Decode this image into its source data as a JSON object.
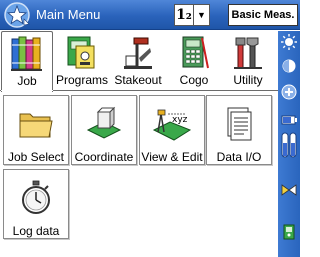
{
  "titlebar": {
    "title": "Main Menu",
    "unit_value": "1₂",
    "mode_button": "Basic Meas."
  },
  "tabs": [
    {
      "label": "Job",
      "icon": "books-icon",
      "active": true
    },
    {
      "label": "Programs",
      "icon": "programs-icon",
      "active": false
    },
    {
      "label": "Stakeout",
      "icon": "stakeout-icon",
      "active": false
    },
    {
      "label": "Cogo",
      "icon": "calculator-icon",
      "active": false
    },
    {
      "label": "Utility",
      "icon": "tools-icon",
      "active": false
    }
  ],
  "buttons": [
    {
      "label": "Job Select",
      "icon": "folder-icon"
    },
    {
      "label": "Coordinate",
      "icon": "coordinate-icon"
    },
    {
      "label": "View & Edit",
      "icon": "view-edit-icon"
    },
    {
      "label": "Data I/O",
      "icon": "data-io-icon"
    },
    {
      "label": "Log data",
      "icon": "stopwatch-icon"
    }
  ],
  "sidebar": {
    "icons": [
      "brightness-icon",
      "contrast-icon",
      "plus-icon",
      "battery-icon",
      "battery-double-icon",
      "compass-icon",
      "device-icon"
    ]
  },
  "colors": {
    "titlebar": "#2a63bb",
    "sidebar": "#3e7ad2",
    "tab_border": "#6b6b6b"
  }
}
